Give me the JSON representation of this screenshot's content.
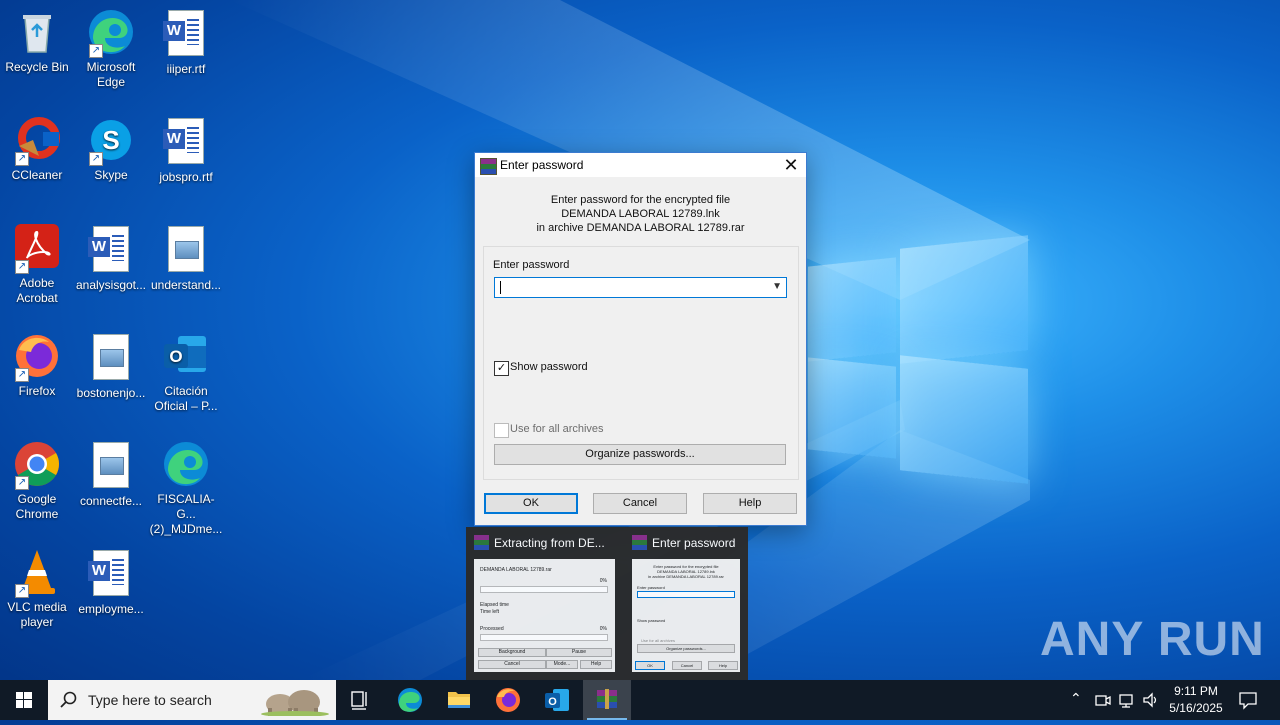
{
  "desktop": {
    "icons": [
      {
        "label": "Recycle Bin"
      },
      {
        "label": "Microsoft Edge"
      },
      {
        "label": "iiiper.rtf"
      },
      {
        "label": "CCleaner"
      },
      {
        "label": "Skype"
      },
      {
        "label": "jobspro.rtf"
      },
      {
        "label": "Adobe Acrobat"
      },
      {
        "label": "analysisgot..."
      },
      {
        "label": "understand..."
      },
      {
        "label": "Firefox"
      },
      {
        "label": "bostonenjo..."
      },
      {
        "label": "Citación Oficial – P..."
      },
      {
        "label": "Google Chrome"
      },
      {
        "label": "connectfe..."
      },
      {
        "label": "FISCALIA-G... (2)_MJDme..."
      },
      {
        "label": "VLC media player"
      },
      {
        "label": "employme..."
      }
    ]
  },
  "dialog": {
    "title": "Enter password",
    "message_line1": "Enter password for the encrypted file",
    "message_line2": "DEMANDA LABORAL 12789.lnk",
    "message_line3": "in archive DEMANDA LABORAL 12789.rar",
    "password_label": "Enter password",
    "password_value": "",
    "show_password_label": "Show password",
    "show_password_checked": true,
    "use_all_label": "Use for all archives",
    "organize_label": "Organize passwords...",
    "ok_label": "OK",
    "cancel_label": "Cancel",
    "help_label": "Help"
  },
  "thumbnails": {
    "extract": {
      "title": "Extracting from DE...",
      "archive": "DEMANDA LABORAL 12789.rar",
      "pct1": "0%",
      "elapsed": "Elapsed time",
      "time_left": "Time left",
      "processed": "Processed",
      "pct2": "0%",
      "background": "Background",
      "pause": "Pause",
      "cancel": "Cancel",
      "mode": "Mode...",
      "help": "Help"
    },
    "password": {
      "title": "Enter password",
      "line1": "Enter password for the encrypted file",
      "line2": "DEMANDA LABORAL 12789.lnk",
      "line3": "in archive DEMANDA LABORAL 12789.rar",
      "enter": "Enter password",
      "show": "Show password",
      "use": "Use for all archives",
      "organize": "Organize passwords...",
      "ok": "OK",
      "cancel": "Cancel",
      "help": "Help"
    }
  },
  "watermark": "ANY RUN",
  "taskbar": {
    "search_placeholder": "Type here to search",
    "time": "9:11 PM",
    "date": "5/16/2025"
  },
  "colors": {
    "accent": "#0078d7",
    "taskbar": "#101a26"
  }
}
